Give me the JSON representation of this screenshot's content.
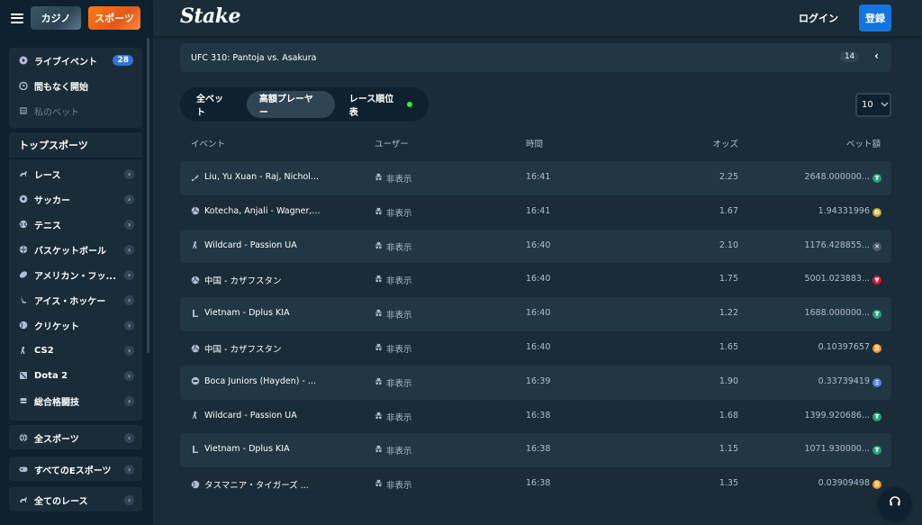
{
  "nav": {
    "casino_tab": "カジノ",
    "sports_tab": "スポーツ"
  },
  "sidebar": {
    "top_items": [
      {
        "label": "ライブイベント",
        "icon": "live-icon",
        "badge": "28"
      },
      {
        "label": "間もなく開始",
        "icon": "clock-icon"
      },
      {
        "label": "私のベット",
        "icon": "bets-icon"
      }
    ],
    "top_sports_heading": "トップスポーツ",
    "sports": [
      {
        "label": "レース",
        "icon": "horse-icon"
      },
      {
        "label": "サッカー",
        "icon": "soccer-icon"
      },
      {
        "label": "テニス",
        "icon": "tennis-icon"
      },
      {
        "label": "バスケットボール",
        "icon": "basketball-icon"
      },
      {
        "label": "アメリカン・フッ...",
        "icon": "football-icon"
      },
      {
        "label": "アイス・ホッケー",
        "icon": "hockey-icon"
      },
      {
        "label": "クリケット",
        "icon": "cricket-icon"
      },
      {
        "label": "CS2",
        "icon": "cs2-icon"
      },
      {
        "label": "Dota 2",
        "icon": "dota-icon"
      },
      {
        "label": "総合格闘技",
        "icon": "mma-icon"
      }
    ],
    "all_sports": "全スポーツ",
    "all_esports": "すべてのEスポーツ",
    "all_races": "全てのレース"
  },
  "header": {
    "logo": "Stake",
    "login": "ログイン",
    "register": "登録"
  },
  "event_bar": {
    "title": "UFC 310: Pantoja vs. Asakura",
    "count": "14"
  },
  "tabs": [
    {
      "label": "全ベット"
    },
    {
      "label": "高額プレーヤー"
    },
    {
      "label": "レース順位表"
    }
  ],
  "rows_select": "10",
  "table": {
    "headers": {
      "event": "イベント",
      "user": "ユーザー",
      "time": "時間",
      "odds": "オッズ",
      "bet": "ベット額"
    },
    "rows": [
      {
        "event": "Liu, Yu Xuan - Raj, Nichol...",
        "icon": "badminton-icon",
        "user": "非表示",
        "time": "16:41",
        "odds": "2.25",
        "bet": "2648.000000...",
        "coin": "usdt",
        "coin_color": "#26a17b"
      },
      {
        "event": "Kotecha, Anjali - Wagner,...",
        "icon": "volleyball-icon",
        "user": "非表示",
        "time": "16:41",
        "odds": "1.67",
        "bet": "1.94331996",
        "coin": "doge",
        "coin_color": "#c2a633"
      },
      {
        "event": "Wildcard - Passion UA",
        "icon": "cs2-icon",
        "user": "非表示",
        "time": "16:40",
        "odds": "2.10",
        "bet": "1176.428855...",
        "coin": "xrp",
        "coin_color": "#4b5c6a"
      },
      {
        "event": "中国 - カザフスタン",
        "icon": "volleyball-icon",
        "user": "非表示",
        "time": "16:40",
        "odds": "1.75",
        "bet": "5001.023883...",
        "coin": "trx",
        "coin_color": "#e8112d"
      },
      {
        "event": "Vietnam - Dplus KIA",
        "icon": "lol-icon",
        "user": "非表示",
        "time": "16:40",
        "odds": "1.22",
        "bet": "1688.000000...",
        "coin": "usdt",
        "coin_color": "#26a17b"
      },
      {
        "event": "中国 - カザフスタン",
        "icon": "volleyball-icon",
        "user": "非表示",
        "time": "16:40",
        "odds": "1.65",
        "bet": "0.10397657",
        "coin": "btc",
        "coin_color": "#f7931a"
      },
      {
        "event": "Boca Juniors (Hayden) - ...",
        "icon": "esoccer-icon",
        "user": "非表示",
        "time": "16:39",
        "odds": "1.90",
        "bet": "0.33739419",
        "coin": "eth",
        "coin_color": "#627eea"
      },
      {
        "event": "Wildcard - Passion UA",
        "icon": "cs2-icon",
        "user": "非表示",
        "time": "16:38",
        "odds": "1.68",
        "bet": "1399.920686...",
        "coin": "usdt",
        "coin_color": "#26a17b"
      },
      {
        "event": "Vietnam - Dplus KIA",
        "icon": "lol-icon",
        "user": "非表示",
        "time": "16:38",
        "odds": "1.15",
        "bet": "1071.930000...",
        "coin": "usdt",
        "coin_color": "#26a17b"
      },
      {
        "event": "タスマニア・タイガーズ ...",
        "icon": "cricket-icon",
        "user": "非表示",
        "time": "16:38",
        "odds": "1.35",
        "bet": "0.03909498",
        "coin": "btc",
        "coin_color": "#f7931a"
      }
    ]
  },
  "colors": {
    "accent": "#1475e1",
    "sports_orange": "#ff7a12",
    "live_dot": "#1fff20",
    "badge_blue": "#2f75db"
  }
}
